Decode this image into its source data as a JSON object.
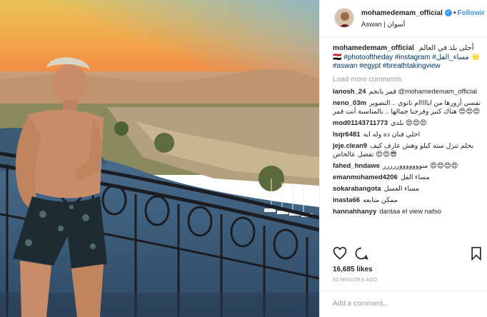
{
  "post": {
    "username": "mohamedemam_official",
    "follow_label": "Followir",
    "location": "Aswan | أسوان",
    "caption_text": "أحلى بلد في العالم 🇪🇬",
    "caption_tags": "#photooftheday #instagram #مساء_الفل 🌟 #aswan #egypt #breathtakingview",
    "load_more": "Load more comments",
    "likes": "16,685 likes",
    "time": "50 MINUTES AGO",
    "add_comment_placeholder": "Add a comment..."
  },
  "comments": [
    {
      "user": "lanosh_24",
      "text": "قمر يانجم @mohamedemam_official"
    },
    {
      "user": "neno_03m",
      "text": "نفسي أزورها من ايااااام تانوي .. التصوير هناك كتير وفرجنا جمالها .. بالمناسبة أنت قمر 😍😍😍"
    },
    {
      "user": "mod01143711773",
      "text": "بلدي 😍😍😍"
    },
    {
      "user": "lsqr6481",
      "text": "احلي فنان ده وله ايه"
    },
    {
      "user": "jeje.clean9",
      "text": "بحلم تنزل سته كيلو وهش عارف كيف تفضل عالخاص 😍😍😎"
    },
    {
      "user": "fahed_hndawe",
      "text": "منوووووووررررر 😍😍😍😍"
    },
    {
      "user": "emanmohamed4206",
      "text": "مساء الفل"
    },
    {
      "user": "sokarabangota",
      "text": "مساء العسل"
    },
    {
      "user": "inasta66",
      "text": "ممكن متابعه"
    },
    {
      "user": "hannahhanyy",
      "text": "dantaa el view nafso"
    }
  ],
  "icons": [
    "verified-badge-icon",
    "heart-icon",
    "comment-icon",
    "bookmark-icon"
  ],
  "colors": {
    "link": "#003569",
    "follow": "#3897f0",
    "muted": "#999999",
    "text": "#262626"
  }
}
